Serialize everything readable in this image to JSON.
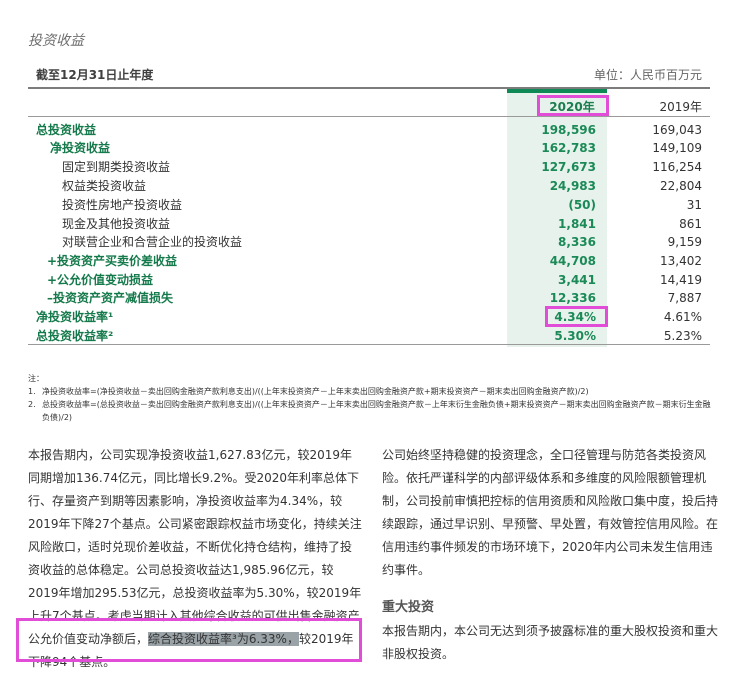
{
  "section_title": "投资收益",
  "period_label": "截至12月31日止年度",
  "unit_label": "单位：人民币百万元",
  "columns": [
    "2020年",
    "2019年"
  ],
  "rows": [
    {
      "label": "总投资收益",
      "v2020": "198,596",
      "v2019": "169,043"
    },
    {
      "label": "净投资收益",
      "v2020": "162,783",
      "v2019": "149,109"
    },
    {
      "label": "固定到期类投资收益",
      "v2020": "127,673",
      "v2019": "116,254"
    },
    {
      "label": "权益类投资收益",
      "v2020": "24,983",
      "v2019": "22,804"
    },
    {
      "label": "投资性房地产投资收益",
      "v2020": "(50)",
      "v2019": "31"
    },
    {
      "label": "现金及其他投资收益",
      "v2020": "1,841",
      "v2019": "861"
    },
    {
      "label": "对联营企业和合营企业的投资收益",
      "v2020": "8,336",
      "v2019": "9,159"
    },
    {
      "label": "+投资资产买卖价差收益",
      "v2020": "44,708",
      "v2019": "13,402"
    },
    {
      "label": "+公允价值变动损益",
      "v2020": "3,441",
      "v2019": "14,419"
    },
    {
      "label": "–投资资产资产减值损失",
      "v2020": "12,336",
      "v2019": "7,887"
    },
    {
      "label": "净投资收益率¹",
      "v2020": "4.34%",
      "v2019": "4.61%"
    },
    {
      "label": "总投资收益率²",
      "v2020": "5.30%",
      "v2019": "5.23%"
    }
  ],
  "notes_title": "注：",
  "notes": [
    {
      "num": "1.",
      "text": "净投资收益率=(净投资收益－卖出回购金融资产款利息支出)/((上年末投资资产－上年末卖出回购金融资产款+期末投资资产－期末卖出回购金融资产款)/2)"
    },
    {
      "num": "2.",
      "text": "总投资收益率=(总投资收益－卖出回购金融资产款利息支出)/((上年末投资资产－上年末卖出回购金融资产款－上年末衍生金融负债+期末投资资产－期末卖出回购金融资产款－期末衍生金融负债)/2)"
    }
  ],
  "para_left": "本报告期内，公司实现净投资收益1,627.83亿元，较2019年同期增加136.74亿元，同比增长9.2%。受2020年利率总体下行、存量资产到期等因素影响，净投资收益率为4.34%，较2019年下降27个基点。公司紧密跟踪权益市场变化，持续关注风险敞口，适时兑现价差收益，不断优化持仓结构，维持了投资收益的总体稳定。公司总投资收益达1,985.96亿元，较2019年增加295.53亿元，总投资收益率为5.30%，较2019年上升7个基点。考虑当期计入其他综合收益的可供出售金融资产公允价值变动净额后，",
  "para_left_mark": "综合投资收益率³为6.33%，",
  "para_left_tail": "较2019年下降94个基点。",
  "para_right": "公司始终坚持稳健的投资理念，全口径管理与防范各类投资风险。依托严谨科学的内部评级体系和多维度的风险限额管理机制，公司投前审慎把控标的信用资质和风险敞口集中度，投后持续跟踪，通过早识别、早预警、早处置，有效管控信用风险。在信用违约事件频发的市场环境下，2020年内公司未发生信用违约事件。",
  "section2_title": "重大投资",
  "para_right2": "本报告期内，本公司无达到须予披露标准的重大股权投资和重大非股权投资。",
  "colors": {
    "accent_green": "#1b8a57",
    "highlight": "#e24dd8",
    "band": "#e7f2ec"
  }
}
